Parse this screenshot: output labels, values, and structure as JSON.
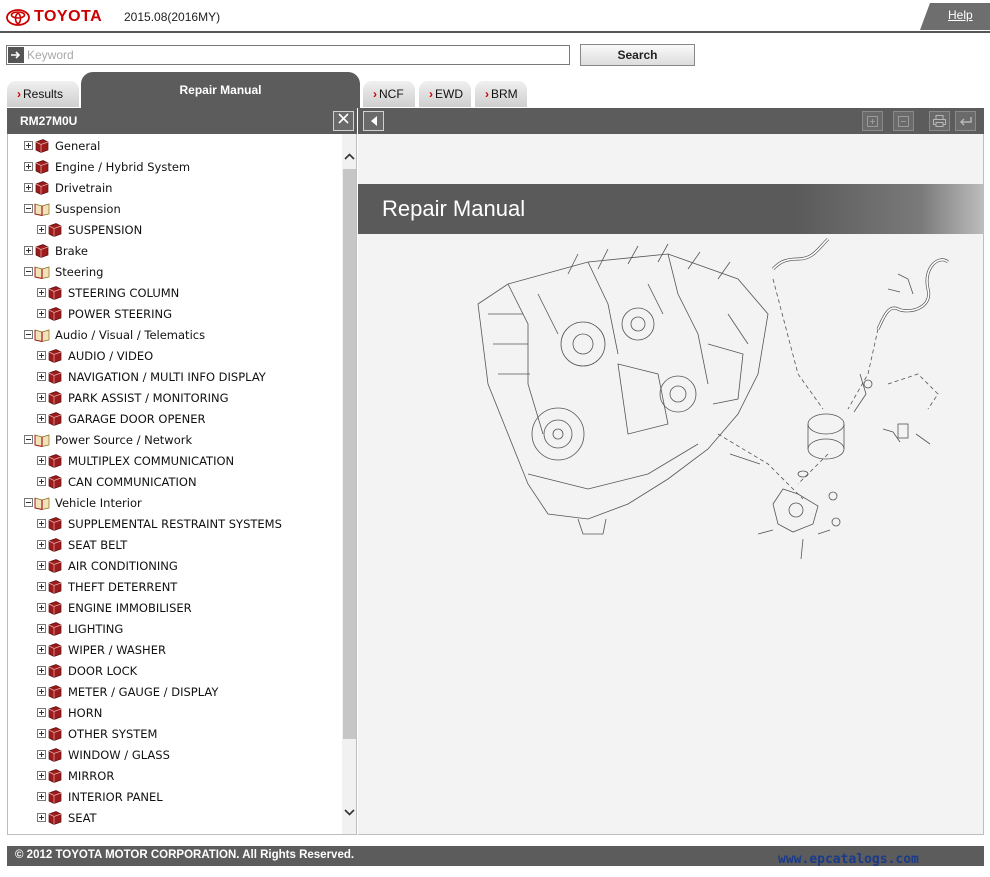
{
  "header": {
    "brand": "TOYOTA",
    "model_year": "2015.08(2016MY)",
    "help_label": "Help"
  },
  "search": {
    "placeholder": "Keyword",
    "value": "",
    "button_label": "Search"
  },
  "tabs": [
    {
      "label": "Results",
      "active": false
    },
    {
      "label": "Repair Manual",
      "active": true
    },
    {
      "label": "NCF",
      "active": false
    },
    {
      "label": "EWD",
      "active": false
    },
    {
      "label": "BRM",
      "active": false
    }
  ],
  "left_panel": {
    "title": "RM27M0U",
    "close_icon": "close-icon"
  },
  "tree": [
    {
      "label": "General",
      "level": 0,
      "expanded": false,
      "icon": "book-closed-icon"
    },
    {
      "label": "Engine / Hybrid System",
      "level": 0,
      "expanded": false,
      "icon": "book-closed-icon"
    },
    {
      "label": "Drivetrain",
      "level": 0,
      "expanded": false,
      "icon": "book-closed-icon"
    },
    {
      "label": "Suspension",
      "level": 0,
      "expanded": true,
      "icon": "book-open-icon"
    },
    {
      "label": "SUSPENSION",
      "level": 1,
      "expanded": false,
      "icon": "book-closed-icon"
    },
    {
      "label": "Brake",
      "level": 0,
      "expanded": false,
      "icon": "book-closed-icon"
    },
    {
      "label": "Steering",
      "level": 0,
      "expanded": true,
      "icon": "book-open-icon"
    },
    {
      "label": "STEERING COLUMN",
      "level": 1,
      "expanded": false,
      "icon": "book-closed-icon"
    },
    {
      "label": "POWER STEERING",
      "level": 1,
      "expanded": false,
      "icon": "book-closed-icon"
    },
    {
      "label": "Audio / Visual / Telematics",
      "level": 0,
      "expanded": true,
      "icon": "book-open-icon"
    },
    {
      "label": "AUDIO / VIDEO",
      "level": 1,
      "expanded": false,
      "icon": "book-closed-icon"
    },
    {
      "label": "NAVIGATION / MULTI INFO DISPLAY",
      "level": 1,
      "expanded": false,
      "icon": "book-closed-icon"
    },
    {
      "label": "PARK ASSIST / MONITORING",
      "level": 1,
      "expanded": false,
      "icon": "book-closed-icon"
    },
    {
      "label": "GARAGE DOOR OPENER",
      "level": 1,
      "expanded": false,
      "icon": "book-closed-icon"
    },
    {
      "label": "Power Source / Network",
      "level": 0,
      "expanded": true,
      "icon": "book-open-icon"
    },
    {
      "label": "MULTIPLEX COMMUNICATION",
      "level": 1,
      "expanded": false,
      "icon": "book-closed-icon"
    },
    {
      "label": "CAN COMMUNICATION",
      "level": 1,
      "expanded": false,
      "icon": "book-closed-icon"
    },
    {
      "label": "Vehicle Interior",
      "level": 0,
      "expanded": true,
      "icon": "book-open-icon"
    },
    {
      "label": "SUPPLEMENTAL RESTRAINT SYSTEMS",
      "level": 1,
      "expanded": false,
      "icon": "book-closed-icon"
    },
    {
      "label": "SEAT BELT",
      "level": 1,
      "expanded": false,
      "icon": "book-closed-icon"
    },
    {
      "label": "AIR CONDITIONING",
      "level": 1,
      "expanded": false,
      "icon": "book-closed-icon"
    },
    {
      "label": "THEFT DETERRENT",
      "level": 1,
      "expanded": false,
      "icon": "book-closed-icon"
    },
    {
      "label": "ENGINE IMMOBILISER",
      "level": 1,
      "expanded": false,
      "icon": "book-closed-icon"
    },
    {
      "label": "LIGHTING",
      "level": 1,
      "expanded": false,
      "icon": "book-closed-icon"
    },
    {
      "label": "WIPER / WASHER",
      "level": 1,
      "expanded": false,
      "icon": "book-closed-icon"
    },
    {
      "label": "DOOR LOCK",
      "level": 1,
      "expanded": false,
      "icon": "book-closed-icon"
    },
    {
      "label": "METER / GAUGE / DISPLAY",
      "level": 1,
      "expanded": false,
      "icon": "book-closed-icon"
    },
    {
      "label": "HORN",
      "level": 1,
      "expanded": false,
      "icon": "book-closed-icon"
    },
    {
      "label": "OTHER SYSTEM",
      "level": 1,
      "expanded": false,
      "icon": "book-closed-icon"
    },
    {
      "label": "WINDOW / GLASS",
      "level": 1,
      "expanded": false,
      "icon": "book-closed-icon"
    },
    {
      "label": "MIRROR",
      "level": 1,
      "expanded": false,
      "icon": "book-closed-icon"
    },
    {
      "label": "INTERIOR PANEL",
      "level": 1,
      "expanded": false,
      "icon": "book-closed-icon"
    },
    {
      "label": "SEAT",
      "level": 1,
      "expanded": false,
      "icon": "book-closed-icon"
    }
  ],
  "content": {
    "title": "Repair Manual",
    "figure": "engine-exploded-diagram"
  },
  "footer": {
    "copyright": "© 2012 TOYOTA MOTOR CORPORATION. All Rights Reserved.",
    "watermark": "www.epcatalogs.com"
  },
  "colors": {
    "brand_red": "#cc0000",
    "toolbar_gray": "#5c5c5c",
    "book_red": "#9e1b1b"
  }
}
